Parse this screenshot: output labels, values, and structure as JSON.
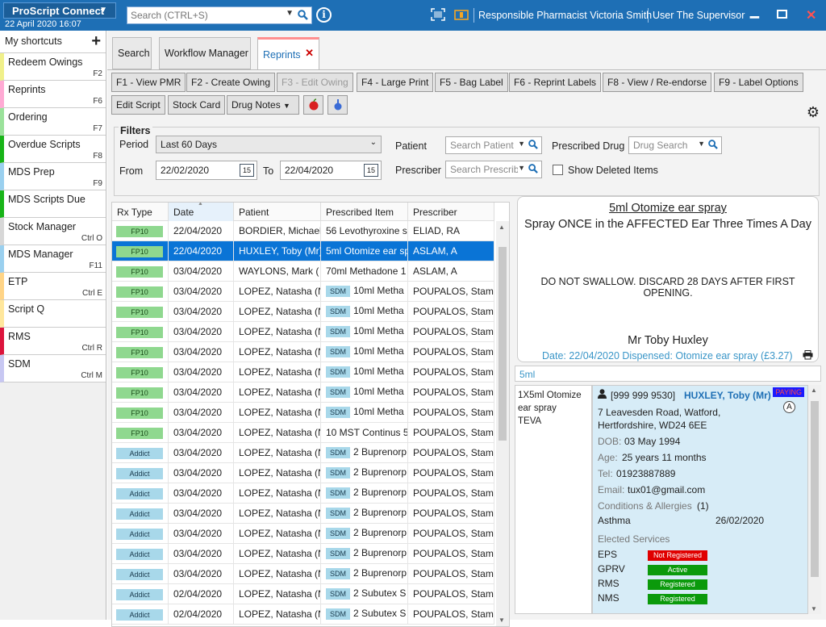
{
  "titlebar": {
    "app_name": "ProScript Connect",
    "datetime": "22 April 2020 16:07",
    "search_placeholder": "Search (CTRL+S)",
    "info_label": "i",
    "pharmacist_text": "Responsible Pharmacist Victoria Smith",
    "user_text": "User The Supervisor",
    "accent_color": "#1e6fb5"
  },
  "sidebar": {
    "header": "My shortcuts",
    "items": [
      {
        "label": "Redeem Owings",
        "key": "F2",
        "color": "#f0f08a"
      },
      {
        "label": "Reprints",
        "key": "F6",
        "color": "#ffaad4"
      },
      {
        "label": "Ordering",
        "key": "F7",
        "color": "#9be29b"
      },
      {
        "label": "Overdue Scripts",
        "key": "F8",
        "color": "#18b418"
      },
      {
        "label": "MDS Prep",
        "key": "F9",
        "color": "#9ad0ef"
      },
      {
        "label": "MDS Scripts Due",
        "key": "",
        "color": "#18b418"
      },
      {
        "label": "Stock Manager",
        "key": "Ctrl O",
        "color": "#d7d7d7"
      },
      {
        "label": "MDS Manager",
        "key": "F11",
        "color": "#9ad0ef"
      },
      {
        "label": "ETP",
        "key": "Ctrl E",
        "color": "#ffd486"
      },
      {
        "label": "Script Q",
        "key": "",
        "color": "#ffe79c"
      },
      {
        "label": "RMS",
        "key": "Ctrl R",
        "color": "#dc143c"
      },
      {
        "label": "SDM",
        "key": "Ctrl M",
        "color": "#c7c7f2"
      }
    ]
  },
  "tabs": [
    "Search",
    "Workflow Manager",
    "Reprints"
  ],
  "toolbar": {
    "row1": [
      "F1 - View PMR",
      "F2 - Create Owing",
      "F3 - Edit Owing",
      "F4 - Large Print",
      "F5 - Bag Label",
      "F6 - Reprint Labels",
      "F8 - View / Re-endorse",
      "F9 - Label Options"
    ],
    "row2": [
      "Edit Script",
      "Stock Card",
      "Drug Notes"
    ]
  },
  "filters": {
    "title": "Filters",
    "period_label": "Period",
    "period_value": "Last 60 Days",
    "from_label": "From",
    "from_value": "22/02/2020",
    "to_label": "To",
    "to_value": "22/04/2020",
    "calendar_day": "15",
    "patient_label": "Patient",
    "patient_placeholder": "Search Patient",
    "prescriber_label": "Prescriber",
    "prescriber_placeholder": "Search Prescrib",
    "drug_label": "Prescribed Drug",
    "drug_placeholder": "Drug Search",
    "show_deleted_label": "Show Deleted Items"
  },
  "grid": {
    "columns": [
      "Rx Type",
      "Date",
      "Patient",
      "Prescribed Item",
      "Prescriber"
    ],
    "rows": [
      {
        "type": "FP10",
        "date": "22/04/2020",
        "patient": "BORDIER, Michael",
        "sdm": "",
        "item": "56 Levothyroxine s",
        "prescriber": "ELIAD, RA"
      },
      {
        "type": "FP10",
        "date": "22/04/2020",
        "patient": "HUXLEY, Toby (Mr)",
        "sdm": "",
        "item": "5ml Otomize ear sp",
        "prescriber": "ASLAM, A"
      },
      {
        "type": "FP10",
        "date": "03/04/2020",
        "patient": "WAYLONS, Mark (",
        "sdm": "",
        "item": "70ml Methadone 1",
        "prescriber": "ASLAM, A"
      },
      {
        "type": "FP10",
        "date": "03/04/2020",
        "patient": "LOPEZ, Natasha (N",
        "sdm": "SDM",
        "item": "10ml Metha",
        "prescriber": "POUPALOS, Stama"
      },
      {
        "type": "FP10",
        "date": "03/04/2020",
        "patient": "LOPEZ, Natasha (N",
        "sdm": "SDM",
        "item": "10ml Metha",
        "prescriber": "POUPALOS, Stama"
      },
      {
        "type": "FP10",
        "date": "03/04/2020",
        "patient": "LOPEZ, Natasha (N",
        "sdm": "SDM",
        "item": "10ml Metha",
        "prescriber": "POUPALOS, Stama"
      },
      {
        "type": "FP10",
        "date": "03/04/2020",
        "patient": "LOPEZ, Natasha (N",
        "sdm": "SDM",
        "item": "10ml Metha",
        "prescriber": "POUPALOS, Stama"
      },
      {
        "type": "FP10",
        "date": "03/04/2020",
        "patient": "LOPEZ, Natasha (N",
        "sdm": "SDM",
        "item": "10ml Metha",
        "prescriber": "POUPALOS, Stama"
      },
      {
        "type": "FP10",
        "date": "03/04/2020",
        "patient": "LOPEZ, Natasha (N",
        "sdm": "SDM",
        "item": "10ml Metha",
        "prescriber": "POUPALOS, Stama"
      },
      {
        "type": "FP10",
        "date": "03/04/2020",
        "patient": "LOPEZ, Natasha (N",
        "sdm": "SDM",
        "item": "10ml Metha",
        "prescriber": "POUPALOS, Stama"
      },
      {
        "type": "FP10",
        "date": "03/04/2020",
        "patient": "LOPEZ, Natasha (N",
        "sdm": "",
        "item": "10 MST Continus 5",
        "prescriber": "POUPALOS, Stama"
      },
      {
        "type": "Addict",
        "date": "03/04/2020",
        "patient": "LOPEZ, Natasha (N",
        "sdm": "SDM",
        "item": "2 Buprenorp",
        "prescriber": "POUPALOS, Stama"
      },
      {
        "type": "Addict",
        "date": "03/04/2020",
        "patient": "LOPEZ, Natasha (N",
        "sdm": "SDM",
        "item": "2 Buprenorp",
        "prescriber": "POUPALOS, Stama"
      },
      {
        "type": "Addict",
        "date": "03/04/2020",
        "patient": "LOPEZ, Natasha (N",
        "sdm": "SDM",
        "item": "2 Buprenorp",
        "prescriber": "POUPALOS, Stama"
      },
      {
        "type": "Addict",
        "date": "03/04/2020",
        "patient": "LOPEZ, Natasha (N",
        "sdm": "SDM",
        "item": "2 Buprenorp",
        "prescriber": "POUPALOS, Stama"
      },
      {
        "type": "Addict",
        "date": "03/04/2020",
        "patient": "LOPEZ, Natasha (N",
        "sdm": "SDM",
        "item": "2 Buprenorp",
        "prescriber": "POUPALOS, Stama"
      },
      {
        "type": "Addict",
        "date": "03/04/2020",
        "patient": "LOPEZ, Natasha (N",
        "sdm": "SDM",
        "item": "2 Buprenorp",
        "prescriber": "POUPALOS, Stama"
      },
      {
        "type": "Addict",
        "date": "03/04/2020",
        "patient": "LOPEZ, Natasha (N",
        "sdm": "SDM",
        "item": "2 Buprenorp",
        "prescriber": "POUPALOS, Stama"
      },
      {
        "type": "Addict",
        "date": "02/04/2020",
        "patient": "LOPEZ, Natasha (N",
        "sdm": "SDM",
        "item": "2 Subutex S",
        "prescriber": "POUPALOS, Stama"
      },
      {
        "type": "Addict",
        "date": "02/04/2020",
        "patient": "LOPEZ, Natasha (N",
        "sdm": "SDM",
        "item": "2 Subutex S",
        "prescriber": "POUPALOS, Stama"
      }
    ]
  },
  "label_preview": {
    "title": "5ml Otomize ear spray",
    "directions": "Spray ONCE in the AFFECTED Ear Three Times A Day",
    "warning": "DO NOT SWALLOW. DISCARD 28 DAYS AFTER FIRST OPENING.",
    "patient": "Mr Toby Huxley",
    "dispensed": "Date: 22/04/2020 Dispensed: Otomize ear spray (£3.27)"
  },
  "description": "5ml",
  "drug_detail": [
    "1X5ml Otomize",
    "ear spray",
    "TEVA"
  ],
  "patient_card": {
    "nhs": "[999 999 9530]",
    "name": "HUXLEY, Toby (Mr)",
    "paying": "PAYING",
    "exempt_letter": "A",
    "address1": "7 Leavesden Road, Watford,",
    "address2": "Hertfordshire, WD24 6EE",
    "dob_label": "DOB:",
    "dob": "03 May 1994",
    "age_label": "Age:",
    "age": "25 years 11 months",
    "tel_label": "Tel:",
    "tel": "01923887889",
    "email_label": "Email:",
    "email": "tux01@gmail.com",
    "conditions_label": "Conditions & Allergies",
    "conditions_count": "(1)",
    "condition": "Asthma",
    "condition_date": "26/02/2020",
    "services_label": "Elected Services",
    "services": [
      {
        "name": "EPS",
        "status": "Not Registered",
        "color": "#e00000"
      },
      {
        "name": "GPRV",
        "status": "Active",
        "color": "#0b9a0b"
      },
      {
        "name": "RMS",
        "status": "Registered",
        "color": "#0b9a0b"
      },
      {
        "name": "NMS",
        "status": "Registered",
        "color": "#0b9a0b"
      }
    ]
  }
}
